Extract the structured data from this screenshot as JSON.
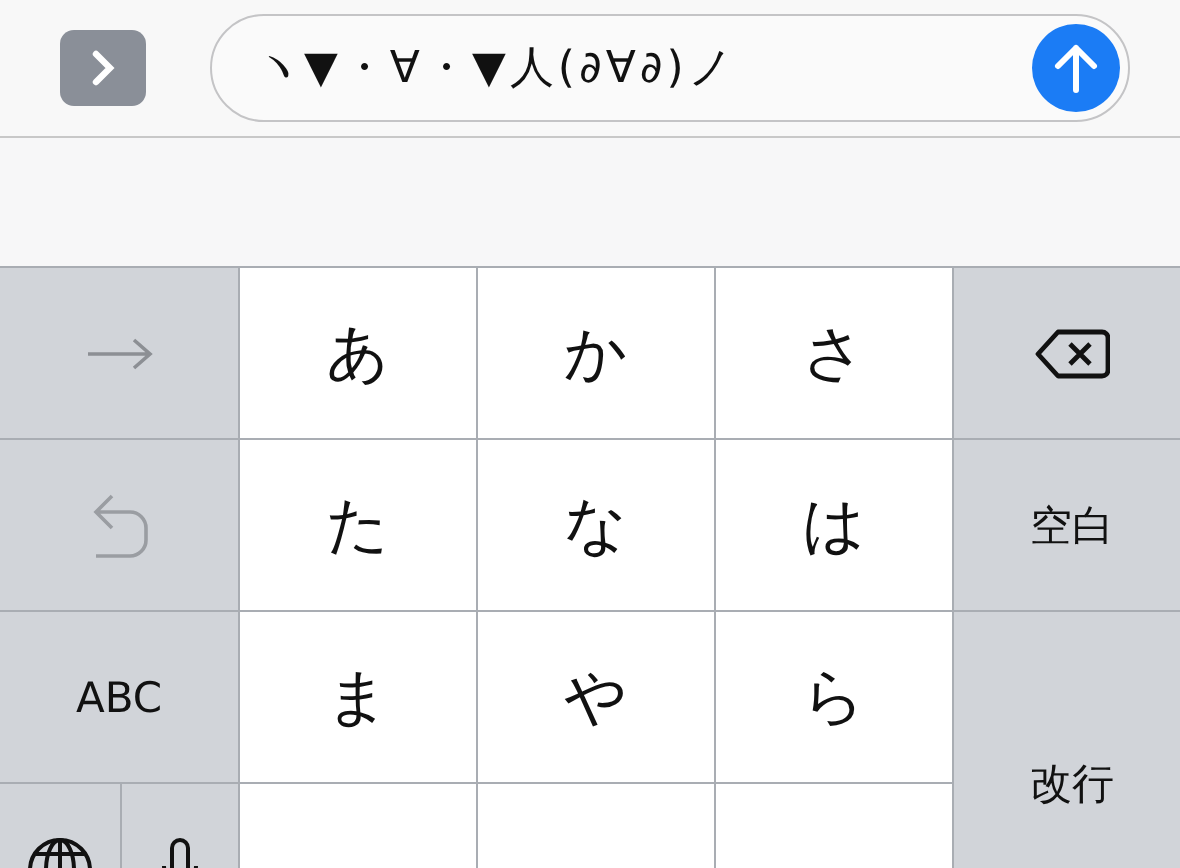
{
  "input_bar": {
    "message_field": {
      "value": "ヽ▼・∀・▼人(∂∀∂)ノ"
    }
  },
  "keyboard": {
    "keys": [
      {
        "kind": "next"
      },
      {
        "kind": "char",
        "label": "あ"
      },
      {
        "kind": "char",
        "label": "か"
      },
      {
        "kind": "char",
        "label": "さ"
      },
      {
        "kind": "delete"
      },
      {
        "kind": "undo"
      },
      {
        "kind": "char",
        "label": "た"
      },
      {
        "kind": "char",
        "label": "な"
      },
      {
        "kind": "char",
        "label": "は"
      },
      {
        "kind": "function",
        "label": "空白"
      },
      {
        "kind": "function",
        "label": "ABC"
      },
      {
        "kind": "char",
        "label": "ま"
      },
      {
        "kind": "char",
        "label": "や"
      },
      {
        "kind": "char",
        "label": "ら"
      },
      {
        "kind": "return",
        "label": "改行"
      },
      {
        "kind": "globe"
      },
      {
        "kind": "mic"
      },
      {
        "kind": "cut"
      },
      {
        "kind": "cut"
      },
      {
        "kind": "cut"
      }
    ]
  }
}
